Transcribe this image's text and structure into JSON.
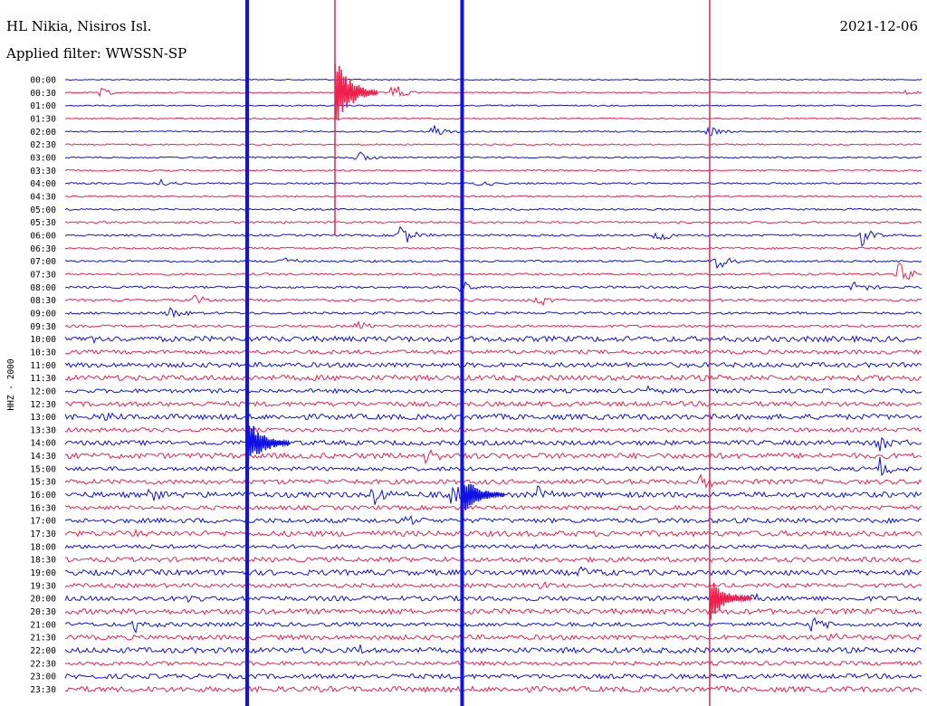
{
  "header": {
    "station": "HL Nikia, Nisiros Isl.",
    "filter": "Applied filter: WWSSN-SP",
    "date": "2021-12-06"
  },
  "chart_data": {
    "type": "line",
    "title": "HL Nikia, Nisiros Isl.",
    "subtitle": "Applied filter: WWSSN-SP",
    "date": "2021-12-06",
    "ylabel": "HHZ - 2000",
    "colors": {
      "even_hour": "#1010e8",
      "odd_hour": "#f0204c"
    },
    "row_labels": [
      "00:00",
      "00:30",
      "01:00",
      "01:30",
      "02:00",
      "02:30",
      "03:00",
      "03:30",
      "04:00",
      "04:30",
      "05:00",
      "05:30",
      "06:00",
      "06:30",
      "07:00",
      "07:30",
      "08:00",
      "08:30",
      "09:00",
      "09:30",
      "10:00",
      "10:30",
      "11:00",
      "11:30",
      "12:00",
      "12:30",
      "13:00",
      "13:30",
      "14:00",
      "14:30",
      "15:00",
      "15:30",
      "16:00",
      "16:30",
      "17:00",
      "17:30",
      "18:00",
      "18:30",
      "19:00",
      "19:30",
      "20:00",
      "20:30",
      "21:00",
      "21:30",
      "22:00",
      "22:30",
      "23:00",
      "23:30"
    ],
    "events": [
      {
        "row": 1,
        "x": 0.38,
        "amp": 14,
        "color": "red"
      },
      {
        "row": 1,
        "x": 0.04,
        "amp": 6,
        "color": "red"
      },
      {
        "row": 1,
        "x": 0.98,
        "amp": 6,
        "color": "red"
      },
      {
        "row": 4,
        "x": 0.43,
        "amp": 10,
        "color": "blue"
      },
      {
        "row": 4,
        "x": 0.75,
        "amp": 8,
        "color": "blue"
      },
      {
        "row": 6,
        "x": 0.34,
        "amp": 10,
        "color": "blue"
      },
      {
        "row": 8,
        "x": 0.48,
        "amp": 6,
        "color": "blue"
      },
      {
        "row": 8,
        "x": 0.11,
        "amp": 6,
        "color": "blue"
      },
      {
        "row": 12,
        "x": 0.39,
        "amp": 16,
        "color": "blue"
      },
      {
        "row": 12,
        "x": 0.69,
        "amp": 12,
        "color": "blue"
      },
      {
        "row": 12,
        "x": 0.93,
        "amp": 14,
        "color": "blue"
      },
      {
        "row": 14,
        "x": 0.25,
        "amp": 8,
        "color": "blue"
      },
      {
        "row": 14,
        "x": 0.76,
        "amp": 12,
        "color": "blue"
      },
      {
        "row": 15,
        "x": 0.97,
        "amp": 18,
        "color": "red"
      },
      {
        "row": 16,
        "x": 0.46,
        "amp": 10,
        "color": "blue"
      },
      {
        "row": 16,
        "x": 0.92,
        "amp": 10,
        "color": "blue"
      },
      {
        "row": 17,
        "x": 0.55,
        "amp": 12,
        "color": "red"
      },
      {
        "row": 17,
        "x": 0.15,
        "amp": 8,
        "color": "red"
      },
      {
        "row": 18,
        "x": 0.12,
        "amp": 8,
        "color": "blue"
      },
      {
        "row": 19,
        "x": 0.34,
        "amp": 8,
        "color": "red"
      },
      {
        "row": 20,
        "x": 0.03,
        "amp": 8,
        "color": "blue"
      },
      {
        "row": 24,
        "x": 0.68,
        "amp": 6,
        "color": "blue"
      },
      {
        "row": 26,
        "x": 0.04,
        "amp": 6,
        "color": "blue"
      },
      {
        "row": 28,
        "x": 0.95,
        "amp": 12,
        "color": "blue"
      },
      {
        "row": 29,
        "x": 0.42,
        "amp": 10,
        "color": "red"
      },
      {
        "row": 30,
        "x": 0.95,
        "amp": 16,
        "color": "blue"
      },
      {
        "row": 31,
        "x": 0.74,
        "amp": 12,
        "color": "red"
      },
      {
        "row": 32,
        "x": 0.36,
        "amp": 16,
        "color": "blue"
      },
      {
        "row": 32,
        "x": 0.45,
        "amp": 16,
        "color": "blue"
      },
      {
        "row": 32,
        "x": 0.55,
        "amp": 12,
        "color": "blue"
      },
      {
        "row": 32,
        "x": 0.1,
        "amp": 10,
        "color": "blue"
      },
      {
        "row": 34,
        "x": 0.4,
        "amp": 8,
        "color": "blue"
      },
      {
        "row": 35,
        "x": 0.07,
        "amp": 6,
        "color": "red"
      },
      {
        "row": 38,
        "x": 0.6,
        "amp": 8,
        "color": "blue"
      },
      {
        "row": 39,
        "x": 0.55,
        "amp": 6,
        "color": "red"
      },
      {
        "row": 40,
        "x": 0.14,
        "amp": 10,
        "color": "blue"
      },
      {
        "row": 40,
        "x": 0.8,
        "amp": 8,
        "color": "blue"
      },
      {
        "row": 42,
        "x": 0.08,
        "amp": 14,
        "color": "blue"
      },
      {
        "row": 42,
        "x": 0.87,
        "amp": 10,
        "color": "blue"
      },
      {
        "row": 43,
        "x": 0.89,
        "amp": 8,
        "color": "red"
      },
      {
        "row": 44,
        "x": 0.34,
        "amp": 8,
        "color": "blue"
      }
    ],
    "spikes": [
      {
        "x": 0.2125,
        "color": "blue",
        "rows": [
          0,
          47
        ],
        "burst_row": 28,
        "burst_amp": 30
      },
      {
        "x": 0.4635,
        "color": "blue",
        "rows": [
          0,
          47
        ],
        "burst_row": 32,
        "burst_amp": 24
      },
      {
        "x": 0.7525,
        "color": "red",
        "rows": [
          0,
          47
        ],
        "burst_row": 40,
        "burst_amp": 26
      },
      {
        "x": 0.315,
        "color": "red",
        "rows": [
          0,
          12
        ],
        "burst_row": 1,
        "burst_amp": 40
      }
    ]
  }
}
